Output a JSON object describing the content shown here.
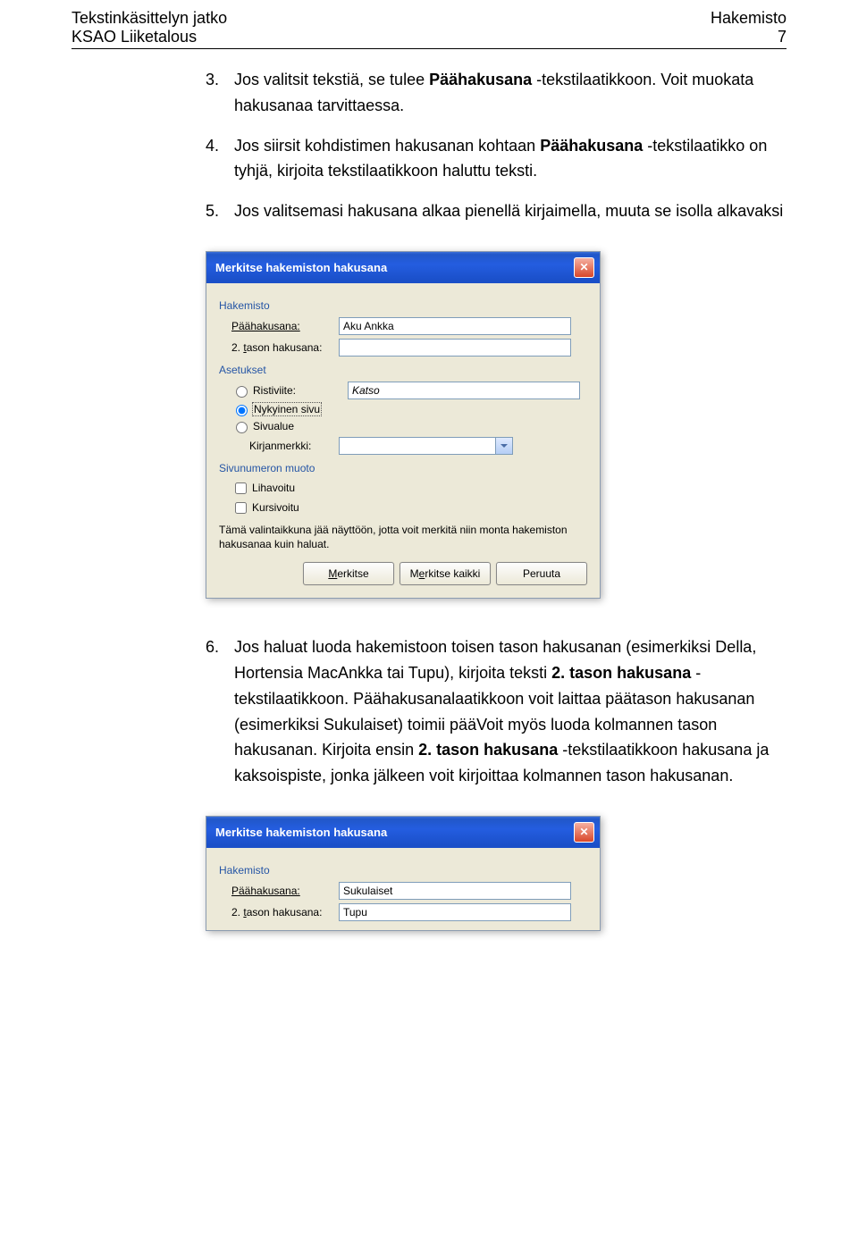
{
  "header": {
    "left1": "Tekstinkäsittelyn jatko",
    "left2": "KSAO Liiketalous",
    "right1": "Hakemisto",
    "right2": "7"
  },
  "items": {
    "n3": "3.",
    "t3a": "Jos valitsit tekstiä, se tulee ",
    "t3b": "Päähakusana",
    "t3c": " -tekstilaatikkoon. Voit muokata hakusanaa tarvittaessa.",
    "n4": "4.",
    "t4a": "Jos siirsit kohdistimen hakusanan kohtaan ",
    "t4b": "Päähakusana",
    "t4c": " -tekstilaatikko on tyhjä, kirjoita tekstilaatikkoon haluttu teksti.",
    "n5": "5.",
    "t5": "Jos valitsemasi hakusana alkaa pienellä kirjaimella, muuta se isolla alkavaksi",
    "n6": "6.",
    "t6a": "Jos haluat luoda hakemistoon toisen tason hakusanan (esimerkiksi Della, Hortensia MacAnkka tai Tupu), kirjoita teksti ",
    "t6b": "2. tason hakusana",
    "t6c": " -tekstilaatikkoon. Päähakusanalaatikkoon voit laittaa päätason hakusanan (esimerkiksi Sukulaiset) toimii pääVoit myös luoda kolmannen tason hakusanan. Kirjoita ensin ",
    "t6d": "2. tason hakusana",
    "t6e": " -tekstilaatikkoon hakusana ja kaksoispiste, jonka jälkeen voit kirjoittaa kolmannen tason hakusanan."
  },
  "dialog1": {
    "title": "Merkitse hakemiston hakusana",
    "section_index": "Hakemisto",
    "label_main": "Päähakusana:",
    "value_main": "Aku Ankka",
    "label_second_a": "2. ",
    "label_second_b": "t",
    "label_second_c": "ason hakusana:",
    "section_settings": "Asetukset",
    "radio_cross_a": "R",
    "radio_cross_b": "istiviite:",
    "value_cross": "Katso",
    "radio_current_a": "N",
    "radio_current_b": "ykyinen sivu",
    "radio_range_a": "Si",
    "radio_range_b": "v",
    "radio_range_c": "ualue",
    "label_bookmark": "Kirjanmerkki:",
    "section_pagenum": "Sivunumeron muoto",
    "check_bold_a": "L",
    "check_bold_b": "ihavoitu",
    "check_italic_a": "K",
    "check_italic_b": "ursivoitu",
    "desc": "Tämä valintaikkuna jää näyttöön, jotta voit merkitä niin monta hakemiston hakusanaa kuin haluat.",
    "btn_mark_a": "M",
    "btn_mark_b": "erkitse",
    "btn_markall_a": "M",
    "btn_markall_b": "e",
    "btn_markall_c": "rkitse kaikki",
    "btn_cancel": "Peruuta"
  },
  "dialog2": {
    "title": "Merkitse hakemiston hakusana",
    "section_index": "Hakemisto",
    "label_main": "Päähakusana:",
    "value_main": "Sukulaiset",
    "label_second_a": "2. ",
    "label_second_b": "t",
    "label_second_c": "ason hakusana:",
    "value_second": "Tupu"
  }
}
